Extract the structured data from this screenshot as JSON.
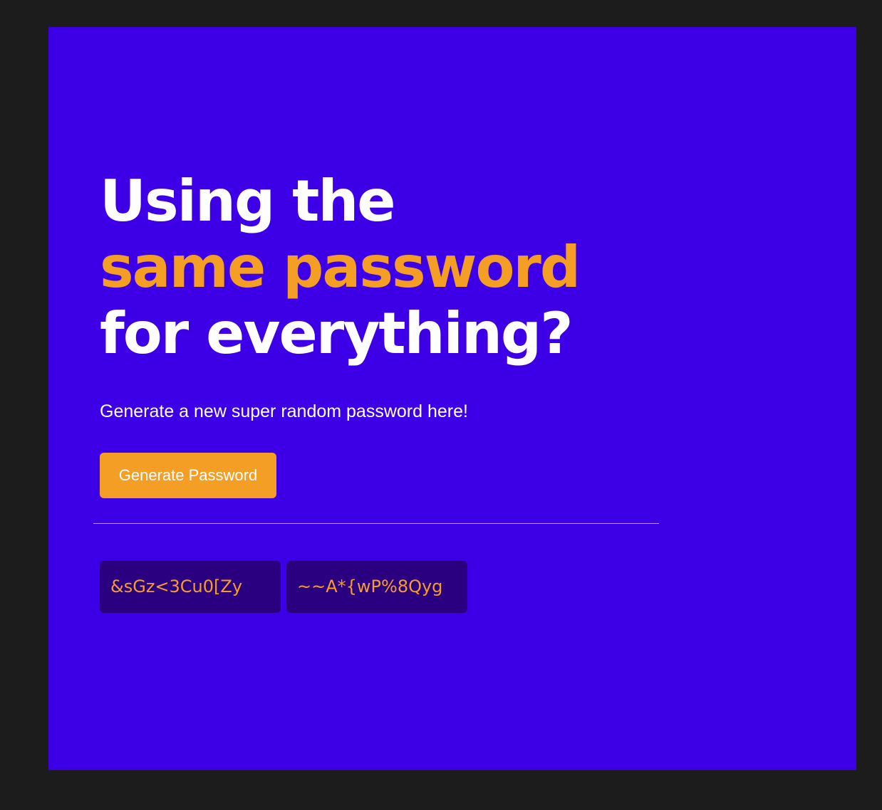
{
  "colors": {
    "page_background": "#1c1c1c",
    "card_background": "#3d00e6",
    "accent": "#f59e25",
    "text": "#ffffff",
    "password_box": "#2a0080"
  },
  "hero": {
    "line1": "Using the",
    "line2": "same password",
    "line3": "for everything?",
    "subtitle": "Generate a new super random password here!"
  },
  "generate_button": {
    "label": "Generate Password"
  },
  "passwords": [
    {
      "value": "&sGz<3Cu0[Zy"
    },
    {
      "value": "~~A*{wP%8Qyg"
    }
  ]
}
